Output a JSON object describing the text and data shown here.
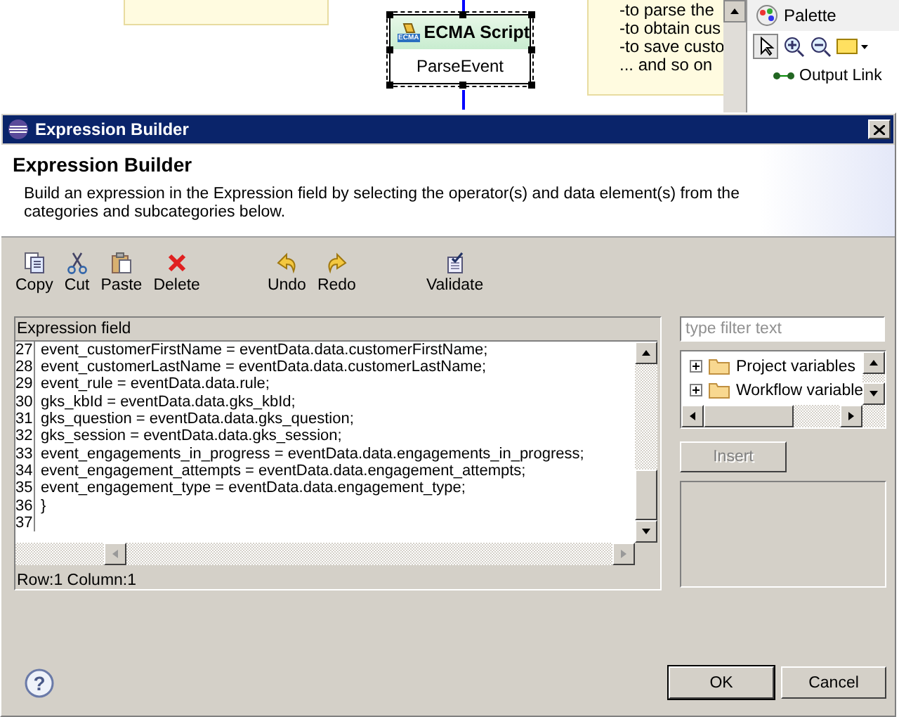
{
  "canvas": {
    "node": {
      "title": "ECMA Script",
      "icon_label": "ECMA",
      "name": "ParseEvent",
      "selected": true
    },
    "note_lines": [
      "-to parse the",
      "-to obtain cus",
      "-to save custo",
      "... and so on"
    ],
    "palette": {
      "title": "Palette",
      "items": [
        {
          "label": "Output Link"
        }
      ]
    }
  },
  "dialog": {
    "title": "Expression Builder",
    "heading": "Expression Builder",
    "description": "Build an expression in the Expression field by selecting the operator(s) and data element(s) from the categories and subcategories below.",
    "toolbar": [
      {
        "kind": "copy",
        "label": "Copy"
      },
      {
        "kind": "cut",
        "label": "Cut"
      },
      {
        "kind": "paste",
        "label": "Paste"
      },
      {
        "kind": "delete",
        "label": "Delete"
      },
      {
        "kind": "undo",
        "label": "Undo"
      },
      {
        "kind": "redo",
        "label": "Redo"
      },
      {
        "kind": "validate",
        "label": "Validate"
      }
    ],
    "expression_field": {
      "label": "Expression field",
      "lines": [
        {
          "number": "27",
          "text": "event_customerFirstName = eventData.data.customerFirstName;"
        },
        {
          "number": "28",
          "text": "event_customerLastName = eventData.data.customerLastName;"
        },
        {
          "number": "29",
          "text": "event_rule = eventData.data.rule;"
        },
        {
          "number": "30",
          "text": "gks_kbId = eventData.data.gks_kbId;"
        },
        {
          "number": "31",
          "text": "gks_question = eventData.data.gks_question;"
        },
        {
          "number": "32",
          "text": "gks_session = eventData.data.gks_session;"
        },
        {
          "number": "33",
          "text": "event_engagements_in_progress = eventData.data.engagements_in_progress;"
        },
        {
          "number": "34",
          "text": "event_engagement_attempts = eventData.data.engagement_attempts;"
        },
        {
          "number": "35",
          "text": "event_engagement_type = eventData.data.engagement_type;"
        },
        {
          "number": "36",
          "text": "}"
        },
        {
          "number": "37"
        }
      ],
      "status": "Row:1 Column:1"
    },
    "filter": {
      "placeholder": "type filter text"
    },
    "tree": [
      {
        "label": "Project variables",
        "expanded": false
      },
      {
        "label": "Workflow variable",
        "expanded": false
      }
    ],
    "insert": {
      "label": "Insert",
      "disabled": true
    },
    "help": {
      "symbol": "?"
    },
    "buttons": [
      {
        "label": "OK",
        "default": true
      },
      {
        "label": "Cancel",
        "default": false
      }
    ]
  }
}
